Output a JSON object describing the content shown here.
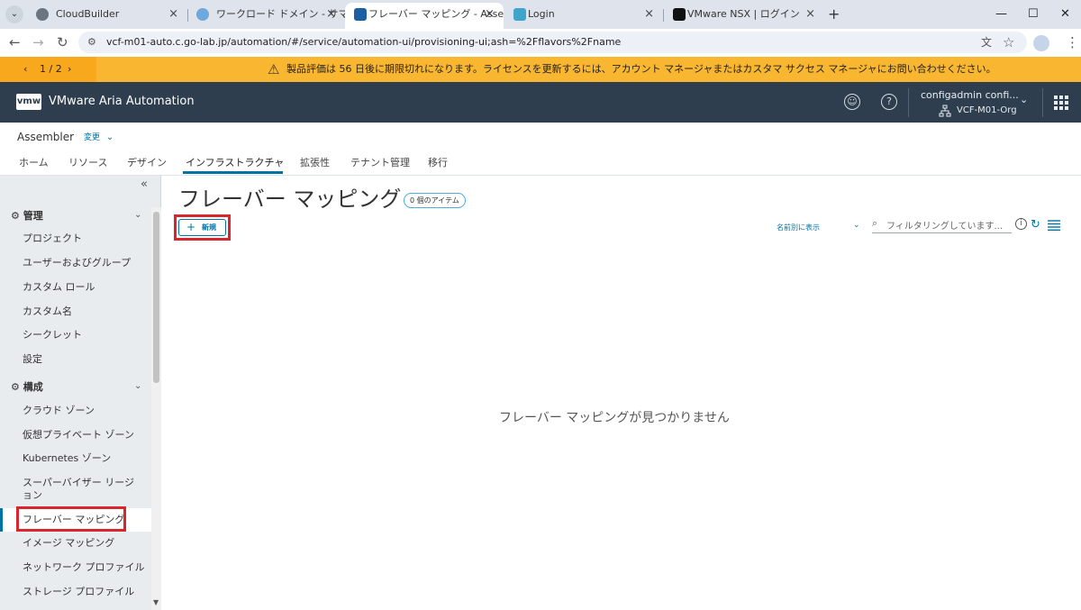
{
  "browser": {
    "tabs": [
      {
        "title": "CloudBuilder",
        "active": false
      },
      {
        "title": "ワークロード ドメイン - サマリ",
        "active": false
      },
      {
        "title": "フレーバー マッピング - Assembler",
        "active": true
      },
      {
        "title": "Login",
        "active": false
      },
      {
        "title": "VMware NSX | ログイン",
        "active": false
      }
    ],
    "close_glyph": "×",
    "new_tab": "+",
    "url": "vcf-m01-auto.c.go-lab.jp/automation/#/service/automation-ui/provisioning-ui;ash=%2Fflavors%2Fname",
    "win": {
      "minimize": "—",
      "maximize": "☐",
      "close": "✕"
    }
  },
  "banner": {
    "pager": "1 / 2",
    "message": "製品評価は 56 日後に期限切れになります。ライセンスを更新するには、アカウント マネージャまたはカスタマ サクセス マネージャにお問い合わせください。",
    "color": "#f9b731"
  },
  "header": {
    "logo": "vmw",
    "title": "VMware Aria Automation",
    "user": "configadmin confi...",
    "org": "VCF-M01-Org",
    "bg_color": "#2e3e4e"
  },
  "service": {
    "name": "Assembler",
    "change": "変更"
  },
  "topnav": [
    "ホーム",
    "リソース",
    "デザイン",
    "インフラストラクチャ",
    "拡張性",
    "テナント管理",
    "移行"
  ],
  "topnav_active": "インフラストラクチャ",
  "sidebar": {
    "sections": [
      {
        "title": "管理",
        "items": [
          "プロジェクト",
          "ユーザーおよびグループ",
          "カスタム ロール",
          "カスタム名",
          "シークレット",
          "設定"
        ]
      },
      {
        "title": "構成",
        "items": [
          "クラウド ゾーン",
          "仮想プライベート ゾーン",
          "Kubernetes ゾーン",
          "スーパーバイザー リージョン",
          "フレーバー マッピング",
          "イメージ マッピング",
          "ネットワーク プロファイル",
          "ストレージ プロファイル"
        ]
      }
    ],
    "active_item": "フレーバー マッピング"
  },
  "main": {
    "title": "フレーバー マッピング",
    "count_badge": "0 個のアイテム",
    "new_button": "新規",
    "sort_label": "名前別に表示",
    "filter_placeholder": "フィルタリングしています...",
    "empty_message": "フレーバー マッピングが見つかりません"
  },
  "colors": {
    "accent": "#0072a3",
    "highlight": "#d8262f",
    "sidebar_bg": "#e8ecef"
  }
}
